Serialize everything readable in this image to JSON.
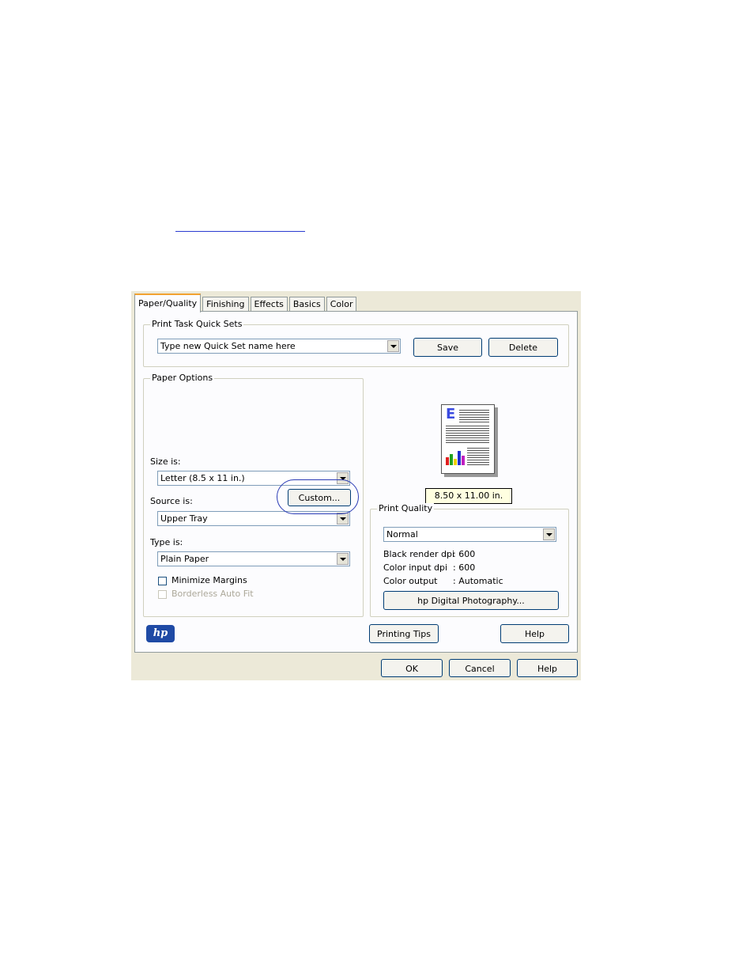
{
  "tabs": [
    "Paper/Quality",
    "Finishing",
    "Effects",
    "Basics",
    "Color"
  ],
  "quick_sets": {
    "legend": "Print Task Quick Sets",
    "value": "Type new Quick Set name here",
    "save_label": "Save",
    "delete_label": "Delete"
  },
  "paper_options": {
    "legend": "Paper Options",
    "size_label": "Size is:",
    "size_value": "Letter (8.5 x 11 in.)",
    "custom_label": "Custom...",
    "source_label": "Source is:",
    "source_value": "Upper Tray",
    "type_label": "Type is:",
    "type_value": "Plain Paper",
    "minimize_margins": "Minimize Margins",
    "borderless": "Borderless Auto Fit"
  },
  "preview": {
    "size_text": "8.50 x 11.00 in.",
    "page_letter": "E"
  },
  "print_quality": {
    "legend": "Print Quality",
    "value": "Normal",
    "black_label": "Black render dpi",
    "black_value": ": 600",
    "color_in_label": "Color input dpi",
    "color_in_value": ": 600",
    "color_out_label": "Color output",
    "color_out_value": ": Automatic",
    "photo_button": "hp Digital Photography..."
  },
  "bottom": {
    "logo_text": "hp",
    "tips_label": "Printing Tips",
    "help_label": "Help",
    "ok_label": "OK",
    "cancel_label": "Cancel",
    "help2_label": "Help"
  },
  "colors": {
    "accent": "#f2a230",
    "circle": "#2a3bb5",
    "logo": "#1f4aa5"
  }
}
